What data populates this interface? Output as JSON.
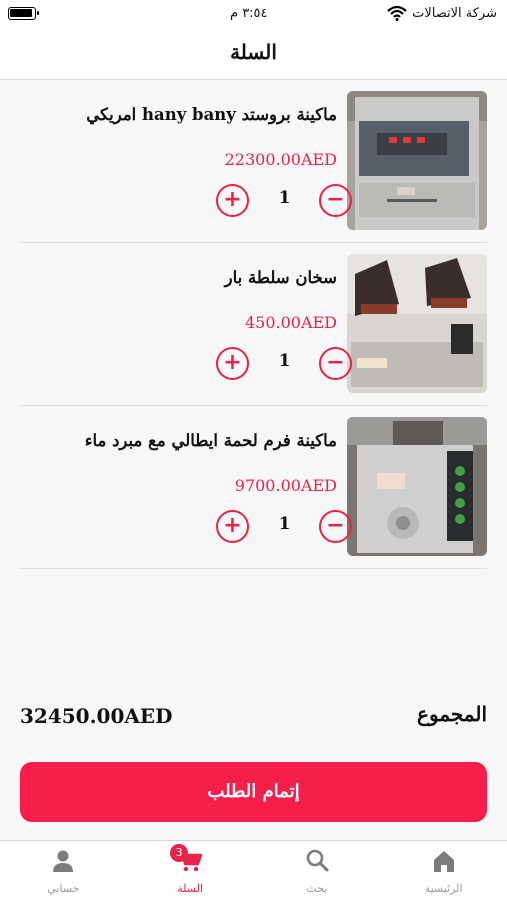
{
  "status_bar": {
    "carrier": "شركة الاتصالات",
    "time": "٣:٥٤ م"
  },
  "header": {
    "title": "السلة"
  },
  "cart": {
    "items": [
      {
        "name": "ماكينة بروستد hany bany امريكي",
        "price": "22300.00AED",
        "quantity": "1"
      },
      {
        "name": "سخان سلطة بار",
        "price": "450.00AED",
        "quantity": "1"
      },
      {
        "name": "ماكينة فرم لحمة ايطالي مع مبرد ماء",
        "price": "9700.00AED",
        "quantity": "1"
      }
    ],
    "plus_symbol": "+",
    "minus_symbol": "−"
  },
  "summary": {
    "total_label": "المجموع",
    "total_value": "32450.00AED"
  },
  "checkout": {
    "label": "إتمام الطلب"
  },
  "tab_bar": {
    "tabs": [
      {
        "label": "الرئيسية",
        "icon": "home-icon"
      },
      {
        "label": "بحث",
        "icon": "search-icon"
      },
      {
        "label": "السلة",
        "icon": "cart-icon",
        "badge": "3",
        "active": true
      },
      {
        "label": "حسابي",
        "icon": "user-icon"
      }
    ]
  },
  "colors": {
    "accent": "#e8234a",
    "checkout": "#f71e4b"
  }
}
